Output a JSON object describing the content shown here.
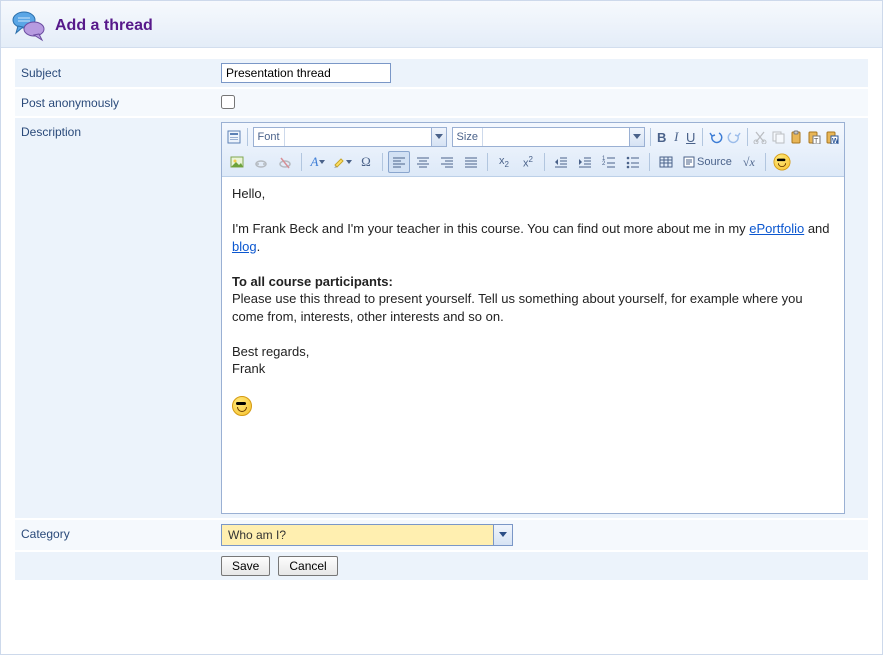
{
  "header": {
    "title": "Add a thread"
  },
  "labels": {
    "subject": "Subject",
    "post_anon": "Post anonymously",
    "description": "Description",
    "category": "Category"
  },
  "fields": {
    "subject_value": "Presentation thread",
    "post_anon_checked": false,
    "category_value": "Who am I?"
  },
  "toolbar": {
    "font_label": "Font",
    "font_value": "",
    "size_label": "Size",
    "size_value": "",
    "source_label": "Source"
  },
  "editor_content": {
    "p1": "Hello,",
    "p2a": "I'm Frank Beck and I'm your teacher in this course. You can find out more about me in my ",
    "p2_link1": "ePortfolio",
    "p2b": " and ",
    "p2_link2": "blog",
    "p2c": ".",
    "p3_bold": "To all course participants:",
    "p3_rest": "Please use this thread to present yourself. Tell us something about yourself, for example where you come from, interests, other interests and so on.",
    "p4a": "Best regards,",
    "p4b": "Frank"
  },
  "buttons": {
    "save": "Save",
    "cancel": "Cancel"
  }
}
